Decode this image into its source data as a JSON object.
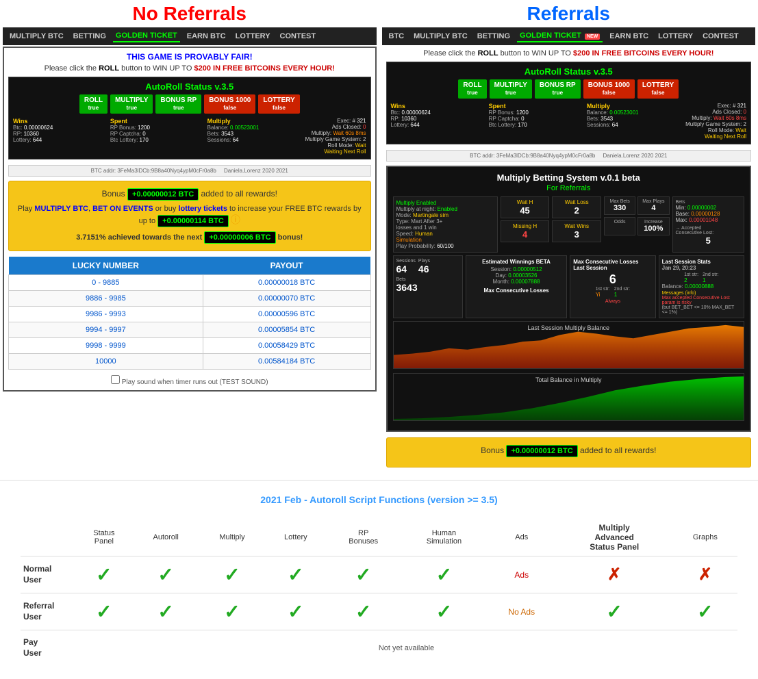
{
  "leftPanel": {
    "title": "No Referrals",
    "nav": {
      "items": [
        {
          "label": "MULTIPLY BTC",
          "active": false
        },
        {
          "label": "BETTING",
          "active": false
        },
        {
          "label": "GOLDEN TICKET",
          "active": true
        },
        {
          "label": "EARN BTC",
          "active": false
        },
        {
          "label": "LOTTERY",
          "active": false
        },
        {
          "label": "CONTEST",
          "active": false
        }
      ]
    },
    "provablyFair": "THIS GAME IS PROVABLY FAIR!",
    "rollText": "Please click the ROLL button to WIN UP TO $200 IN FREE BITCOINS EVERY HOUR!",
    "autoroll": {
      "title": "AutoRoll Status v.3.5",
      "buttons": [
        {
          "label": "ROLL",
          "state": "true",
          "green": true
        },
        {
          "label": "MULTIPLY",
          "state": "true",
          "green": true
        },
        {
          "label": "BONUS RP",
          "state": "true",
          "green": true
        },
        {
          "label": "BONUS 1000",
          "state": "false",
          "green": false
        },
        {
          "label": "LOTTERY",
          "state": "false",
          "green": false
        }
      ],
      "exec": {
        "number": "321",
        "adsClosed": "0",
        "multiply": "Wait 60s 8ms",
        "multiplyGS": "2",
        "rollMode": "Wait",
        "waiting": "Waiting Next Roll"
      },
      "wins": {
        "btc": "0.00000624",
        "rp": "10360",
        "lottery": "644"
      },
      "spent": {
        "rpBonus": "1200",
        "rpCaptcha": "0",
        "btcLottery": "170"
      },
      "multiply": {
        "balance": "0.00523001",
        "bets": "3543",
        "sessions": "64"
      }
    },
    "bonus": {
      "line1": "Bonus",
      "amount1": "+0.00000012 BTC",
      "line2text": "added to all rewards!",
      "playText": "Play",
      "multiplyLink": "MULTIPLY BTC",
      "betText": "BET ON EVENTS",
      "orText": "or buy",
      "lotteryLink": "lottery tickets",
      "increaseText": "to increase your FREE BTC rewards by up to",
      "amount2": "+0.00000114 BTC",
      "progressText": "3.7151% achieved towards the next",
      "amount3": "+0.00000006 BTC",
      "bonusEnd": "bonus!"
    },
    "payoutTable": {
      "headers": [
        "LUCKY NUMBER",
        "PAYOUT"
      ],
      "rows": [
        {
          "range": "0 - 9885",
          "payout": "0.00000018 BTC"
        },
        {
          "range": "9886 - 9985",
          "payout": "0.00000070 BTC"
        },
        {
          "range": "9986 - 9993",
          "payout": "0.00000596 BTC"
        },
        {
          "range": "9994 - 9997",
          "payout": "0.00005854 BTC"
        },
        {
          "range": "9998 - 9999",
          "payout": "0.00058429 BTC"
        },
        {
          "range": "10000",
          "payout": "0.00584184 BTC"
        }
      ]
    },
    "soundCheck": "Play sound when timer runs out (TEST SOUND)"
  },
  "rightPanel": {
    "title": "Referrals",
    "nav": {
      "items": [
        {
          "label": "BTC",
          "active": false
        },
        {
          "label": "MULTIPLY BTC",
          "active": false
        },
        {
          "label": "BETTING",
          "active": false
        },
        {
          "label": "GOLDEN TICKET",
          "active": true,
          "badge": "NEW"
        },
        {
          "label": "EARN BTC",
          "active": false
        },
        {
          "label": "LOTTERY",
          "active": false
        },
        {
          "label": "CONTEST",
          "active": false
        }
      ]
    },
    "rollText": "Please click the ROLL button to WIN UP TO $200 IN FREE BITCOINS EVERY HOUR!",
    "multiply": {
      "title": "Multiply Betting System v.0.1 beta",
      "subtitle": "For Referrals",
      "settings": {
        "multiplyEnabled": "Multiply Enabled",
        "nightEnabled": "Multiply at night: Enabled",
        "mode": "Mode: Martingale sim",
        "type": "Type: Mart After 3+",
        "losses1win": "losses and 1 win",
        "speed": "Speed: Human",
        "simulation": "Simulation",
        "playProbability": "Play Probability: 60/100"
      },
      "waitH": "45",
      "missingH": "4",
      "waitLoss": "2",
      "waitWins": "3",
      "maxBets": "330",
      "maxPlays": "4",
      "odds": "Odds",
      "increase": "100%",
      "bets": {
        "min": "0.00000002",
        "base": "0.00000128",
        "max": "0.00001048"
      },
      "acceptedConsLost": "5",
      "sessions": "64",
      "plays": "46",
      "betsCount": "3643",
      "estimatedWinnings": {
        "session": "0.00000512",
        "day": "0.00003526",
        "month": "0.00007888"
      },
      "maxConsLost": {
        "lastSession": "6",
        "str1st": "Yi",
        "str2nd": "1"
      },
      "lastSessionStats": {
        "date": "Jan 29, 20:23",
        "str1st": "2",
        "str2nd": "1",
        "balance": "0.00000888"
      },
      "messages": "Messages (info)",
      "maxAccepted": "Max accepted Consecutive Lost param is risky",
      "params": "(but BET_BET <= 10% MAX_BET <= 1%)"
    },
    "bonus": {
      "text": "Bonus",
      "amount": "+0.00000012 BTC",
      "suffix": "added to all rewards!"
    }
  },
  "comparison": {
    "title": "2021 Feb - Autoroll Script Functions (version >= 3.5)",
    "headers": [
      {
        "label": "Status\nPanel",
        "bold": false
      },
      {
        "label": "Autoroll",
        "bold": false
      },
      {
        "label": "Multiply",
        "bold": false
      },
      {
        "label": "Lottery",
        "bold": false
      },
      {
        "label": "RP\nBonuses",
        "bold": false
      },
      {
        "label": "Human\nSimulation",
        "bold": false
      },
      {
        "label": "Ads",
        "bold": false
      },
      {
        "label": "Multiply\nAdvanced\nStatus Panel",
        "bold": true
      },
      {
        "label": "Graphs",
        "bold": false
      }
    ],
    "rows": [
      {
        "userLabel": "Normal\nUser",
        "values": [
          "check",
          "check",
          "check",
          "check",
          "check",
          "check",
          "ads",
          "cross",
          "cross"
        ]
      },
      {
        "userLabel": "Referral\nUser",
        "values": [
          "check",
          "check",
          "check",
          "check",
          "check",
          "check",
          "noads",
          "check",
          "check"
        ]
      },
      {
        "userLabel": "Pay\nUser",
        "values": [
          "notavail",
          "notavail",
          "notavail",
          "notavail",
          "notavail",
          "notavail",
          "notavail",
          "notavail",
          "notavail"
        ]
      }
    ],
    "adsLabel": "Ads",
    "noAdsLabel": "No Ads",
    "notYetAvailable": "Not yet available"
  }
}
